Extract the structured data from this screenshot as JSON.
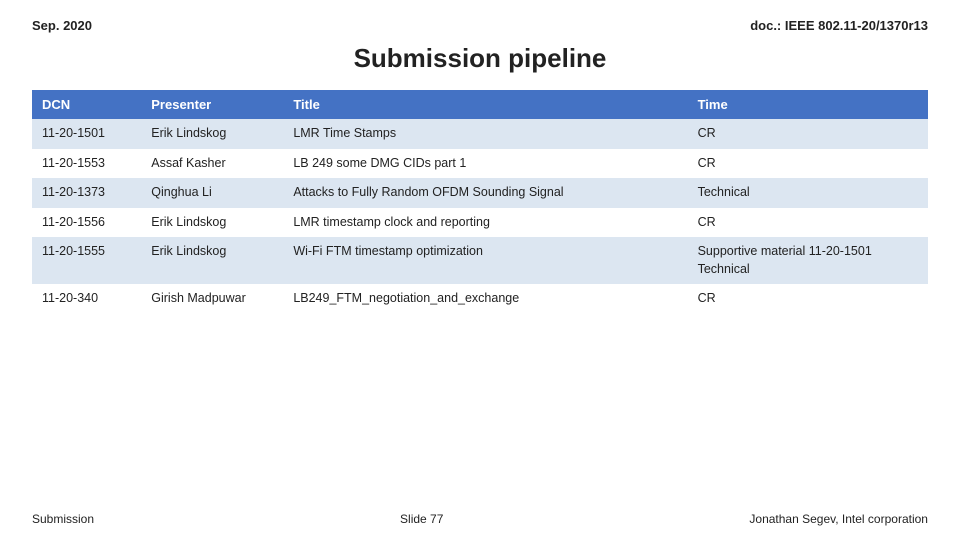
{
  "header": {
    "left": "Sep. 2020",
    "right": "doc.: IEEE 802.11-20/1370r13"
  },
  "title": "Submission pipeline",
  "table": {
    "columns": [
      "DCN",
      "Presenter",
      "Title",
      "Time"
    ],
    "rows": [
      {
        "dcn": "11-20-1501",
        "presenter": "Erik Lindskog",
        "title": "LMR Time Stamps",
        "time": "CR"
      },
      {
        "dcn": "11-20-1553",
        "presenter": "Assaf Kasher",
        "title": "LB 249 some DMG CIDs part 1",
        "time": "CR"
      },
      {
        "dcn": "11-20-1373",
        "presenter": "Qinghua Li",
        "title": "Attacks to Fully Random OFDM Sounding Signal",
        "time": "Technical"
      },
      {
        "dcn": "11-20-1556",
        "presenter": "Erik Lindskog",
        "title": "LMR timestamp clock and reporting",
        "time": "CR"
      },
      {
        "dcn": "11-20-1555",
        "presenter": "Erik Lindskog",
        "title": "Wi-Fi FTM timestamp optimization",
        "time": "Supportive material 11-20-1501\nTechnical"
      },
      {
        "dcn": "11-20-340",
        "presenter": "Girish Madpuwar",
        "title": "LB249_FTM_negotiation_and_exchange",
        "time": "CR"
      }
    ]
  },
  "footer": {
    "left": "Submission",
    "center": "Slide 77",
    "right": "Jonathan Segev, Intel corporation"
  }
}
